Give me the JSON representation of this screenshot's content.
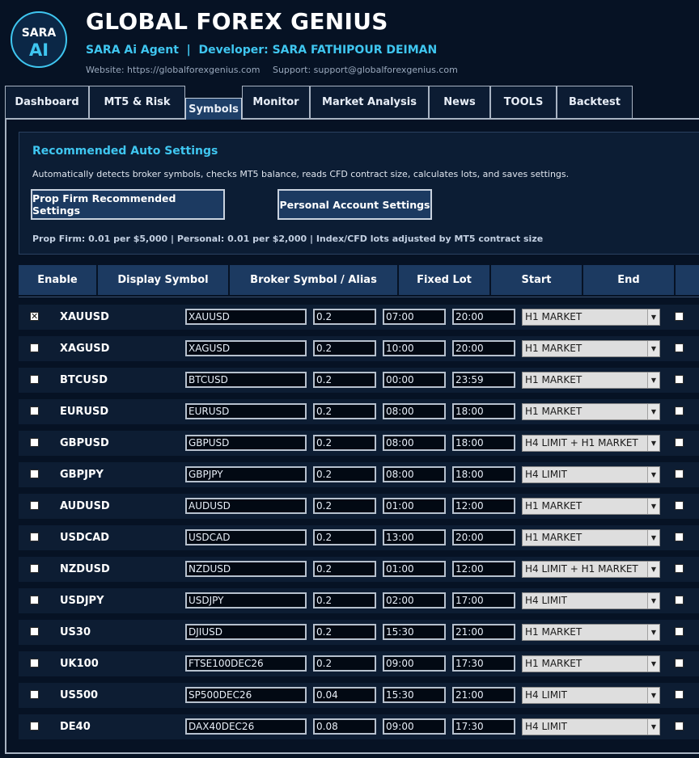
{
  "logo": {
    "line1": "SARA",
    "line2": "AI"
  },
  "app": {
    "title": "GLOBAL FOREX GENIUS",
    "subtitle": "SARA Ai Agent  |  Developer: SARA FATHIPOUR DEIMAN",
    "website": "Website: https://globalforexgenius.com",
    "support": "Support: support@globalforexgenius.com"
  },
  "tabs": [
    "Dashboard",
    "MT5 & Risk",
    "Symbols",
    "Monitor",
    "Market Analysis",
    "News",
    "TOOLS",
    "Backtest"
  ],
  "active_tab": "Symbols",
  "recommended": {
    "title": "Recommended Auto Settings",
    "description": "Automatically detects broker symbols, checks MT5 balance, reads CFD contract size, calculates lots, and saves settings.",
    "prop_button": "Prop Firm Recommended Settings",
    "personal_button": "Personal Account Settings",
    "note": "Prop Firm: 0.01 per $5,000 | Personal: 0.01 per $2,000 | Index/CFD lots adjusted by MT5 contract size"
  },
  "table": {
    "headers": [
      "Enable",
      "Display Symbol",
      "Broker Symbol / Alias",
      "Fixed Lot",
      "Start",
      "End"
    ],
    "rows": [
      {
        "enabled": true,
        "symbol": "XAUUSD",
        "alias": "XAUUSD",
        "lot": "0.2",
        "start": "07:00",
        "end": "20:00",
        "mode": "H1 MARKET"
      },
      {
        "enabled": false,
        "symbol": "XAGUSD",
        "alias": "XAGUSD",
        "lot": "0.2",
        "start": "10:00",
        "end": "20:00",
        "mode": "H1 MARKET"
      },
      {
        "enabled": false,
        "symbol": "BTCUSD",
        "alias": "BTCUSD",
        "lot": "0.2",
        "start": "00:00",
        "end": "23:59",
        "mode": "H1 MARKET"
      },
      {
        "enabled": false,
        "symbol": "EURUSD",
        "alias": "EURUSD",
        "lot": "0.2",
        "start": "08:00",
        "end": "18:00",
        "mode": "H1 MARKET"
      },
      {
        "enabled": false,
        "symbol": "GBPUSD",
        "alias": "GBPUSD",
        "lot": "0.2",
        "start": "08:00",
        "end": "18:00",
        "mode": "H4 LIMIT + H1 MARKET"
      },
      {
        "enabled": false,
        "symbol": "GBPJPY",
        "alias": "GBPJPY",
        "lot": "0.2",
        "start": "08:00",
        "end": "18:00",
        "mode": "H4 LIMIT"
      },
      {
        "enabled": false,
        "symbol": "AUDUSD",
        "alias": "AUDUSD",
        "lot": "0.2",
        "start": "01:00",
        "end": "12:00",
        "mode": "H1 MARKET"
      },
      {
        "enabled": false,
        "symbol": "USDCAD",
        "alias": "USDCAD",
        "lot": "0.2",
        "start": "13:00",
        "end": "20:00",
        "mode": "H1 MARKET"
      },
      {
        "enabled": false,
        "symbol": "NZDUSD",
        "alias": "NZDUSD",
        "lot": "0.2",
        "start": "01:00",
        "end": "12:00",
        "mode": "H4 LIMIT + H1 MARKET"
      },
      {
        "enabled": false,
        "symbol": "USDJPY",
        "alias": "USDJPY",
        "lot": "0.2",
        "start": "02:00",
        "end": "17:00",
        "mode": "H4 LIMIT"
      },
      {
        "enabled": false,
        "symbol": "US30",
        "alias": "DJIUSD",
        "lot": "0.2",
        "start": "15:30",
        "end": "21:00",
        "mode": "H1 MARKET"
      },
      {
        "enabled": false,
        "symbol": "UK100",
        "alias": "FTSE100DEC26",
        "lot": "0.2",
        "start": "09:00",
        "end": "17:30",
        "mode": "H1 MARKET"
      },
      {
        "enabled": false,
        "symbol": "US500",
        "alias": "SP500DEC26",
        "lot": "0.04",
        "start": "15:30",
        "end": "21:00",
        "mode": "H4 LIMIT"
      },
      {
        "enabled": false,
        "symbol": "DE40",
        "alias": "DAX40DEC26",
        "lot": "0.08",
        "start": "09:00",
        "end": "17:30",
        "mode": "H4 LIMIT"
      }
    ]
  },
  "icons": {
    "checkbox_checked": "x-mark-icon",
    "dropdown": "chevron-down-icon"
  },
  "colors": {
    "background": "#061224",
    "accent": "#3fc6f0",
    "header_bg": "#1c3a61",
    "row_bg": "#0d1d33"
  }
}
